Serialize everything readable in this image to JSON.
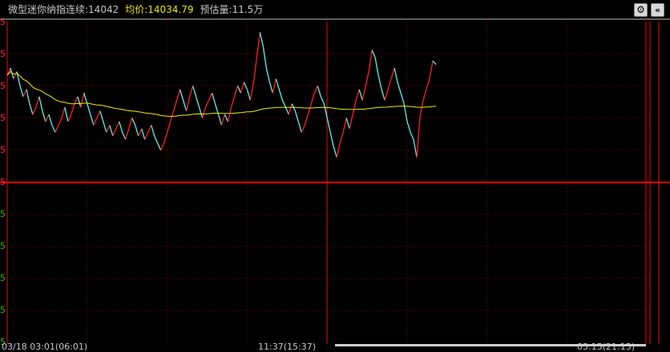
{
  "header": {
    "title": "微型迷你纳指连续:14042",
    "avg_label": "均价:",
    "avg_value": "14034.79",
    "volume": "预估量:11.5万"
  },
  "icons": {
    "settings": "gear-icon",
    "collapse": "chevrons-left-icon"
  },
  "y_axis_top_labels": [
    "5",
    "5",
    "5",
    "5",
    "5",
    "5"
  ],
  "y_axis_bottom_labels": [
    "5",
    "5",
    "5",
    "5",
    "5"
  ],
  "x_axis_labels": [
    "03/18 03:01(06:01)",
    "11:37(15:37)",
    "03:15(21:15)"
  ],
  "colors": {
    "background": "#000000",
    "up": "#ff2020",
    "down": "#60f0f0",
    "average": "#f0f000",
    "grid": "#8b0000",
    "frame": "#ff0000"
  },
  "chart_data": {
    "type": "line",
    "series": [
      {
        "values": [
          14050,
          14052,
          14049,
          14051,
          14047,
          14044,
          14046,
          14042,
          14039,
          14041,
          14044,
          14040,
          14037,
          14039,
          14036,
          14034,
          14036,
          14038,
          14041,
          14037,
          14039,
          14042,
          14044,
          14041,
          14045,
          14042,
          14039,
          14036,
          14038,
          14040,
          14037,
          14034,
          14036,
          14033,
          14035,
          14037,
          14034,
          14032,
          14035,
          14038,
          14036,
          14033,
          14035,
          14032,
          14034,
          14036,
          14033,
          14031,
          14029,
          14031,
          14034,
          14037,
          14040,
          14043,
          14046,
          14043,
          14040,
          14044,
          14047,
          14044,
          14041,
          14038,
          14041,
          14043,
          14045,
          14042,
          14039,
          14036,
          14039,
          14037,
          14041,
          14044,
          14047,
          14045,
          14048,
          14046,
          14043,
          14048,
          14055,
          14062,
          14058,
          14052,
          14048,
          14045,
          14049,
          14046,
          14043,
          14041,
          14039,
          14042,
          14040,
          14037,
          14034,
          14036,
          14039,
          14042,
          14045,
          14047,
          14044,
          14042,
          14038,
          14034,
          14030,
          14027,
          14031,
          14034,
          14038,
          14035,
          14039,
          14043,
          14046,
          14043,
          14047,
          14051,
          14057,
          14055,
          14050,
          14046,
          14043,
          14046,
          14049,
          14052,
          14048,
          14045,
          14042,
          14037,
          14034,
          14032,
          14027,
          14038,
          14043,
          14046,
          14049,
          14054,
          14053
        ]
      }
    ],
    "ylim": [
      14020,
      14065
    ]
  }
}
